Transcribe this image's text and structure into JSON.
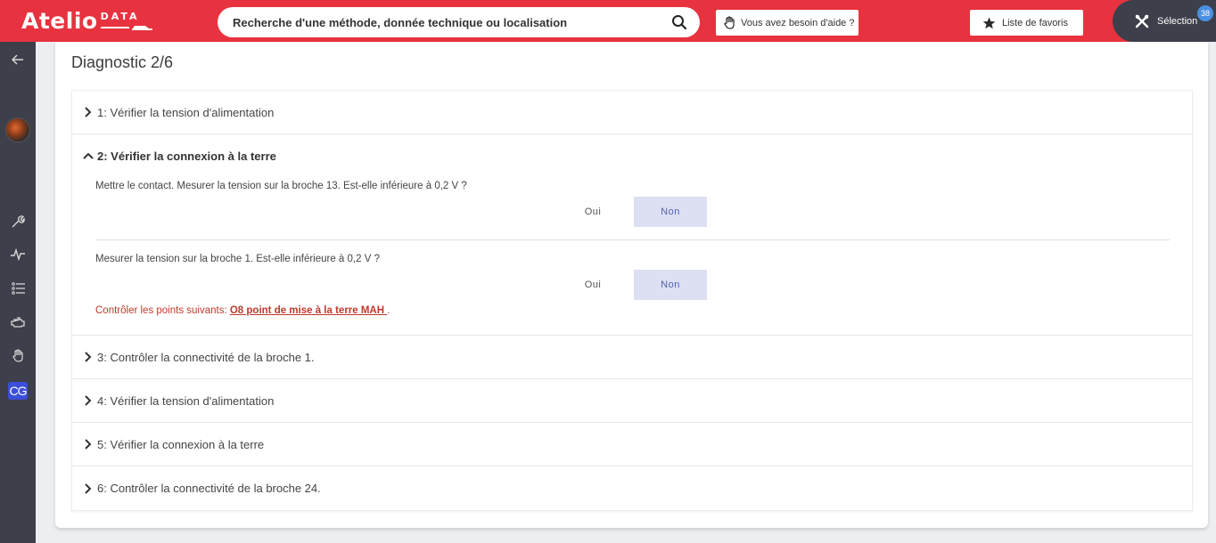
{
  "header": {
    "logo_main": "Atelio",
    "logo_sub": "DATA",
    "search_placeholder": "Recherche d'une méthode, donnée technique ou localisation",
    "help_label": "Vous avez besoin d'aide ?",
    "favorites_label": "Liste de favoris",
    "selection_label": "Sélection",
    "selection_count": "38",
    "brand_color": "#e8323f"
  },
  "sidebar": {
    "items": [
      "back-arrow-icon",
      "vehicle-avatar",
      "wrench-icon",
      "pulse-icon",
      "list-icon",
      "engine-icon",
      "hand-icon",
      "cg-logo"
    ],
    "cg_label": "CG"
  },
  "main": {
    "title": "Diagnostic 2/6",
    "steps": [
      {
        "label": "1: Vérifier la tension d'alimentation",
        "expanded": false
      },
      {
        "label": "2: Vérifier la connexion à la terre",
        "expanded": true
      },
      {
        "label": "3: Contrôler la connectivité de la broche 1.",
        "expanded": false
      },
      {
        "label": "4: Vérifier la tension d'alimentation",
        "expanded": false
      },
      {
        "label": "5: Vérifier la connexion à la terre",
        "expanded": false
      },
      {
        "label": "6: Contrôler la connectivité de la broche 24.",
        "expanded": false
      }
    ],
    "questions": [
      {
        "text": "Mettre le contact. Mesurer la tension sur la broche 13. Est-elle inférieure à 0,2 V ?",
        "yes": "Oui",
        "no": "Non",
        "selected": "Non"
      },
      {
        "text": "Mesurer la tension sur la broche 1. Est-elle inférieure à 0,2 V ?",
        "yes": "Oui",
        "no": "Non",
        "selected": "Non"
      }
    ],
    "control_prefix": "Contrôler les points suivants: ",
    "control_link": "O8 point de mise à la terre MAH ",
    "control_suffix": "."
  }
}
